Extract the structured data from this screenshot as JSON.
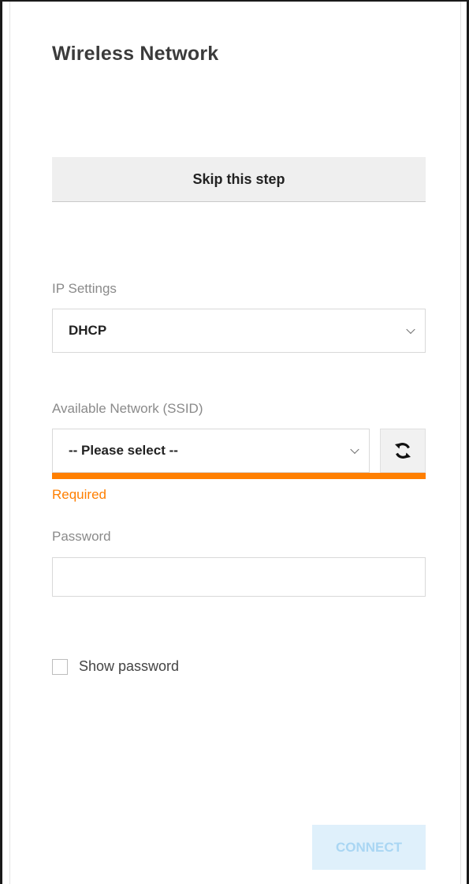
{
  "header": {
    "title": "Wireless Network"
  },
  "skip": {
    "label": "Skip this step"
  },
  "ip_settings": {
    "label": "IP Settings",
    "value": "DHCP"
  },
  "network": {
    "label": "Available Network (SSID)",
    "value": "-- Please select --",
    "error": "Required",
    "refresh_icon": "refresh-icon"
  },
  "password": {
    "label": "Password",
    "value": "",
    "placeholder": ""
  },
  "show_password": {
    "label": "Show password",
    "checked": false
  },
  "connect": {
    "label": "CONNECT"
  },
  "colors": {
    "accent_error": "#ff7f00",
    "connect_bg_disabled": "#dff0fb",
    "connect_text_disabled": "#a9d6f3"
  }
}
